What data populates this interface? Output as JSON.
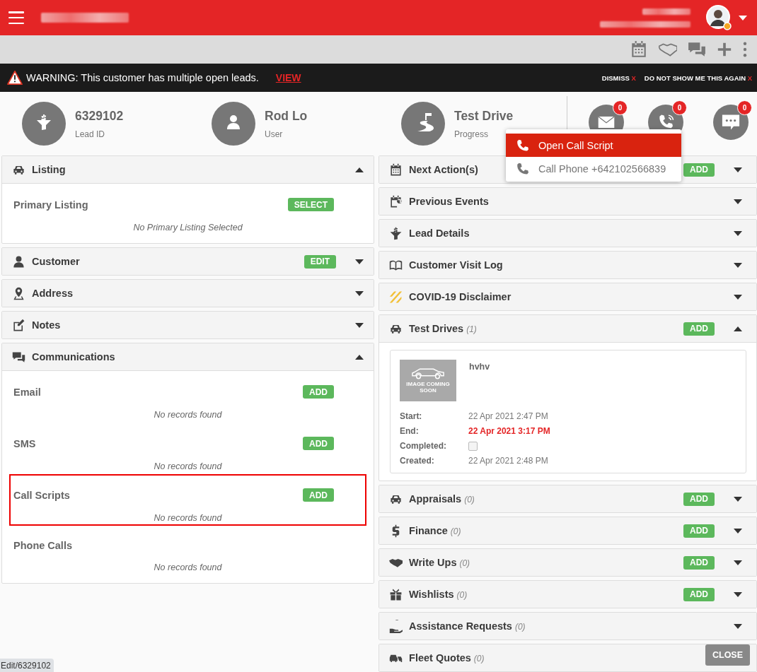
{
  "warning": {
    "text": "WARNING: This customer has multiple open leads.",
    "link": "VIEW",
    "actions": [
      {
        "label": "DISMISS",
        "close": "X"
      },
      {
        "label": "DO NOT SHOW ME THIS AGAIN",
        "close": "X"
      }
    ]
  },
  "summary": [
    {
      "value": "6329102",
      "label": "Lead ID"
    },
    {
      "value": "Rod Lo",
      "label": "User"
    },
    {
      "value": "Test Drive",
      "label": "Progress"
    }
  ],
  "comm_counts": [
    "0",
    "0",
    "0"
  ],
  "popup": [
    {
      "label": "Open Call Script",
      "selected": true
    },
    {
      "label": "Call Phone +642102566839",
      "selected": false
    }
  ],
  "left_panels": [
    {
      "title": "Listing",
      "expanded": true,
      "sections": [
        {
          "title": "Primary Listing",
          "button": "SELECT",
          "empty": "No Primary Listing Selected",
          "highlighted": false
        }
      ]
    },
    {
      "title": "Customer",
      "expanded": false,
      "button": "EDIT"
    },
    {
      "title": "Address",
      "expanded": false
    },
    {
      "title": "Notes",
      "expanded": false
    },
    {
      "title": "Communications",
      "expanded": true,
      "sections": [
        {
          "title": "Email",
          "button": "ADD",
          "empty": "No records found",
          "highlighted": false
        },
        {
          "title": "SMS",
          "button": "ADD",
          "empty": "No records found",
          "highlighted": false
        },
        {
          "title": "Call Scripts",
          "button": "ADD",
          "empty": "No records found",
          "highlighted": true
        },
        {
          "title": "Phone Calls",
          "empty": "No records found",
          "highlighted": false
        }
      ]
    }
  ],
  "right_panels": [
    {
      "title": "Next Action(s)",
      "button": "ADD",
      "expanded": false
    },
    {
      "title": "Previous Events",
      "expanded": false
    },
    {
      "title": "Lead Details",
      "expanded": false
    },
    {
      "title": "Customer Visit Log",
      "expanded": false
    },
    {
      "title": "COVID-19 Disclaimer",
      "expanded": false
    },
    {
      "title": "Test Drives",
      "count": "(1)",
      "button": "ADD",
      "expanded": true,
      "test_drive": {
        "name": "hvhv",
        "image_text": "IMAGE COMING SOON",
        "fields": [
          {
            "label": "Start:",
            "kind": "text",
            "value": "22 Apr 2021 2:47 PM"
          },
          {
            "label": "End:",
            "kind": "alert",
            "value": "22 Apr 2021 3:17 PM"
          },
          {
            "label": "Completed:",
            "kind": "checkbox",
            "checked": false
          },
          {
            "label": "Created:",
            "kind": "text",
            "value": "22 Apr 2021 2:48 PM"
          }
        ]
      }
    },
    {
      "title": "Appraisals",
      "count": "(0)",
      "button": "ADD",
      "expanded": false
    },
    {
      "title": "Finance",
      "count": "(0)",
      "button": "ADD",
      "expanded": false
    },
    {
      "title": "Write Ups",
      "count": "(0)",
      "button": "ADD",
      "expanded": false
    },
    {
      "title": "Wishlists",
      "count": "(0)",
      "button": "ADD",
      "expanded": false
    },
    {
      "title": "Assistance Requests",
      "count": "(0)",
      "expanded": false
    },
    {
      "title": "Fleet Quotes",
      "count": "(0)"
    }
  ],
  "close_button": "CLOSE",
  "status_url": "Edit/6329102"
}
